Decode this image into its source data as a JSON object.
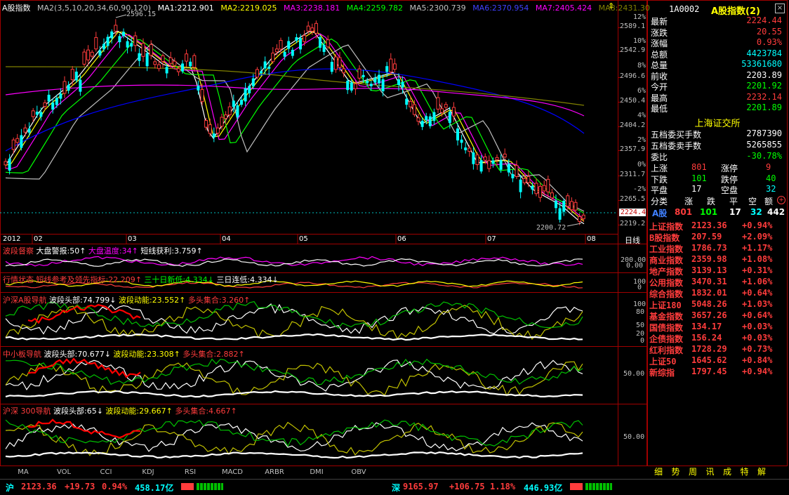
{
  "header": {
    "title": "A股指数",
    "ma2_params": "MA2(3,5,10,20,34,60,90,120)",
    "ma": [
      {
        "label": "MA1:2212.901",
        "color": "#ffffff"
      },
      {
        "label": "MA2:2219.025",
        "color": "#ffff00"
      },
      {
        "label": "MA3:2238.181",
        "color": "#ff00ff"
      },
      {
        "label": "MA4:2259.782",
        "color": "#00ff00"
      },
      {
        "label": "MA5:2300.739",
        "color": "#c0c0c0"
      },
      {
        "label": "MA6:2370.954",
        "color": "#0000ff"
      },
      {
        "label": "MA7:2405.424",
        "color": "#ff00ff"
      },
      {
        "label": "MA8:2431.30",
        "color": "#808000"
      }
    ]
  },
  "price_axis": {
    "labels": [
      "2589.1",
      "2542.9",
      "2496.6",
      "2450.4",
      "2404.2",
      "2357.9",
      "2311.7",
      "2265.5",
      "2219.2"
    ],
    "pct_labels": [
      "12%",
      "10%",
      "8%",
      "6%",
      "4%",
      "2%",
      "0%",
      "-2%"
    ],
    "current": "2224.4",
    "high_label": "2596.15",
    "low_label": "2200.72"
  },
  "timeline": {
    "year": "2012",
    "months": [
      "02",
      "03",
      "04",
      "05",
      "06",
      "07",
      "08"
    ],
    "period": "日线"
  },
  "panels": {
    "p1": {
      "name": "波段督察",
      "items": [
        {
          "t": "大盘警报:50↑",
          "c": "#ffffff"
        },
        {
          "t": "大盘温度:34↑",
          "c": "#ff00ff"
        },
        {
          "t": "短线获利:3.759↑",
          "c": "#ffffff"
        }
      ],
      "axis": [
        "200.00",
        "0.00"
      ]
    },
    "p2": {
      "name": "行情状态",
      "items": [
        {
          "t": "短线参考及领先指标:22.209↑",
          "c": "#ff3c3c"
        },
        {
          "t": "三十日新低:4.334↓",
          "c": "#00ff00"
        },
        {
          "t": "三日连低:4.334↓",
          "c": "#ffffff"
        }
      ],
      "axis": [
        "100",
        "0"
      ]
    },
    "p3": {
      "name": "沪深A股导航",
      "items": [
        {
          "t": "波段头部:74.799↓",
          "c": "#ffffff"
        },
        {
          "t": "波段动能:23.552↑",
          "c": "#ffff00"
        },
        {
          "t": "多头集合:3.260↑",
          "c": "#ff3c3c"
        }
      ],
      "axis": [
        "100",
        "80",
        "50",
        "20",
        "0"
      ]
    },
    "p4": {
      "name": "中小板导航",
      "items": [
        {
          "t": "波段头部:70.677↓",
          "c": "#ffffff"
        },
        {
          "t": "波段动能:23.308↑",
          "c": "#ffff00"
        },
        {
          "t": "多头集合:2.882↑",
          "c": "#ff3c3c"
        }
      ],
      "axis": [
        "50.00"
      ]
    },
    "p5": {
      "name": "沪深 300导航",
      "items": [
        {
          "t": "波段头部:65↓",
          "c": "#ffffff"
        },
        {
          "t": "波段动能:29.667↑",
          "c": "#ffff00"
        },
        {
          "t": "多头集合:4.667↑",
          "c": "#ff3c3c"
        }
      ],
      "axis": [
        "50.00"
      ]
    }
  },
  "bottom_tabs": [
    "MA",
    "VOL",
    "CCI",
    "KDJ",
    "RSI",
    "MACD",
    "ARBR",
    "DMI",
    "OBV"
  ],
  "right_panel": {
    "code": "1A0002",
    "name": "A股指数(2)",
    "quote": [
      {
        "k": "最新",
        "v": "2224.44",
        "c": "#ff3c3c"
      },
      {
        "k": "涨跌",
        "v": "20.55",
        "c": "#ff3c3c"
      },
      {
        "k": "涨幅",
        "v": "0.93%",
        "c": "#ff3c3c"
      },
      {
        "k": "总额",
        "v": "4423784",
        "c": "#00ffff"
      },
      {
        "k": "总量",
        "v": "53361680",
        "c": "#00ffff"
      },
      {
        "k": "前收",
        "v": "2203.89",
        "c": "#ffffff"
      },
      {
        "k": "今开",
        "v": "2201.92",
        "c": "#00ff00"
      },
      {
        "k": "最高",
        "v": "2232.14",
        "c": "#ff3c3c"
      },
      {
        "k": "最低",
        "v": "2201.89",
        "c": "#00ff00"
      }
    ],
    "exchange": "上海证交所",
    "book": [
      {
        "k": "五档委买手数",
        "v": "2787390",
        "c": "#ffffff"
      },
      {
        "k": "五档委卖手数",
        "v": "5265855",
        "c": "#ffffff"
      },
      {
        "k": "委比",
        "v": "-30.78%",
        "c": "#00ff00"
      }
    ],
    "breadth": [
      {
        "k1": "上涨",
        "v1": "801",
        "c1": "#ff3c3c",
        "k2": "涨停",
        "v2": "9",
        "c2": "#ff3c3c"
      },
      {
        "k1": "下跌",
        "v1": "101",
        "c1": "#00ff00",
        "k2": "跌停",
        "v2": "40",
        "c2": "#00ff00"
      },
      {
        "k1": "平盘",
        "v1": "17",
        "c1": "#ffffff",
        "k2": "空盘",
        "v2": "32",
        "c2": "#00ffff"
      }
    ],
    "category_header": [
      "分类",
      "涨",
      "跌",
      "平",
      "空",
      "额"
    ],
    "category_row": [
      "A股",
      "801",
      "101",
      "17",
      "32",
      "442"
    ],
    "indices": [
      {
        "n": "上证指数",
        "p": "2123.36",
        "c": "+0.94%"
      },
      {
        "n": "B股指数",
        "p": "207.59",
        "c": "+2.09%"
      },
      {
        "n": "工业指数",
        "p": "1786.73",
        "c": "+1.17%"
      },
      {
        "n": "商业指数",
        "p": "2359.98",
        "c": "+1.08%"
      },
      {
        "n": "地产指数",
        "p": "3139.13",
        "c": "+0.31%"
      },
      {
        "n": "公用指数",
        "p": "3470.31",
        "c": "+1.06%"
      },
      {
        "n": "综合指数",
        "p": "1832.01",
        "c": "+0.64%"
      },
      {
        "n": "上证180",
        "p": "5048.26",
        "c": "+1.03%"
      },
      {
        "n": "基金指数",
        "p": "3657.26",
        "c": "+0.64%"
      },
      {
        "n": "国债指数",
        "p": "134.17",
        "c": "+0.03%"
      },
      {
        "n": "企债指数",
        "p": "156.24",
        "c": "+0.03%"
      },
      {
        "n": "红利指数",
        "p": "1728.29",
        "c": "+0.73%"
      },
      {
        "n": "上证50",
        "p": "1645.62",
        "c": "+0.84%"
      },
      {
        "n": "新综指",
        "p": "1797.45",
        "c": "+0.94%"
      }
    ],
    "func_tabs": [
      "细",
      "势",
      "周",
      "讯",
      "成",
      "特",
      "解"
    ]
  },
  "status_bar": {
    "sh": {
      "label": "沪",
      "price": "2123.36",
      "chg": "+19.73",
      "pct": "0.94%",
      "amt": "458.17亿"
    },
    "sz": {
      "label": "深",
      "price": "9165.97",
      "chg": "+106.75",
      "pct": "1.18%",
      "amt": "446.93亿"
    }
  }
}
